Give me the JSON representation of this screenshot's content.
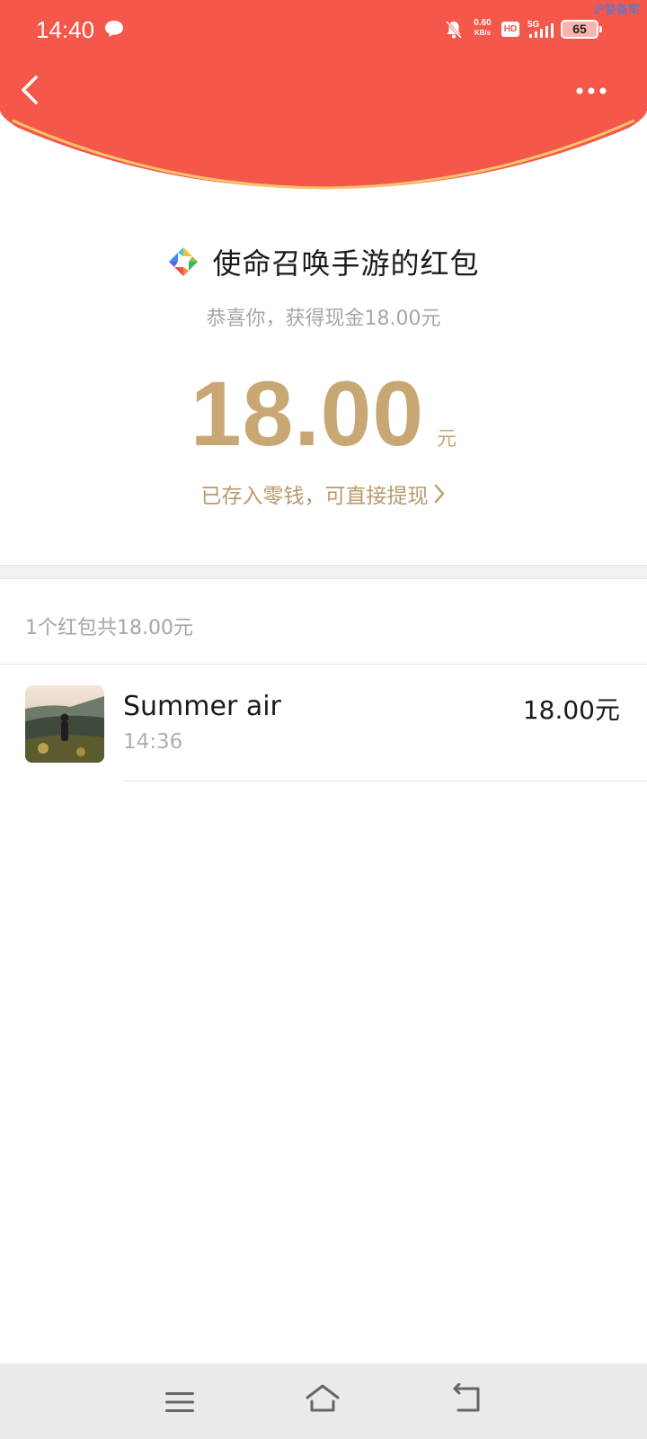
{
  "status_bar": {
    "time": "14:40",
    "net_speed_value": "0.60",
    "net_speed_unit": "KB/s",
    "hd_label": "HD",
    "network_label": "5G",
    "battery_level": "65",
    "watermark": "沪警备案"
  },
  "header": {
    "bg_color": "#f5574a",
    "back_icon": "chevron-left-icon",
    "more_icon": "more-dots-icon"
  },
  "envelope": {
    "title": "使命召唤手游的红包",
    "subtitle": "恭喜你，获得现金18.00元",
    "amount": "18.00",
    "unit": "元",
    "withdraw_text": "已存入零钱，可直接提现",
    "accent_color": "#c9a774"
  },
  "records": {
    "summary": "1个红包共18.00元",
    "items": [
      {
        "name": "Summer air",
        "time": "14:36",
        "amount": "18.00元"
      }
    ]
  },
  "nav_bar": {
    "menu_icon": "menu-icon",
    "home_icon": "home-icon",
    "back_icon": "back-icon"
  }
}
